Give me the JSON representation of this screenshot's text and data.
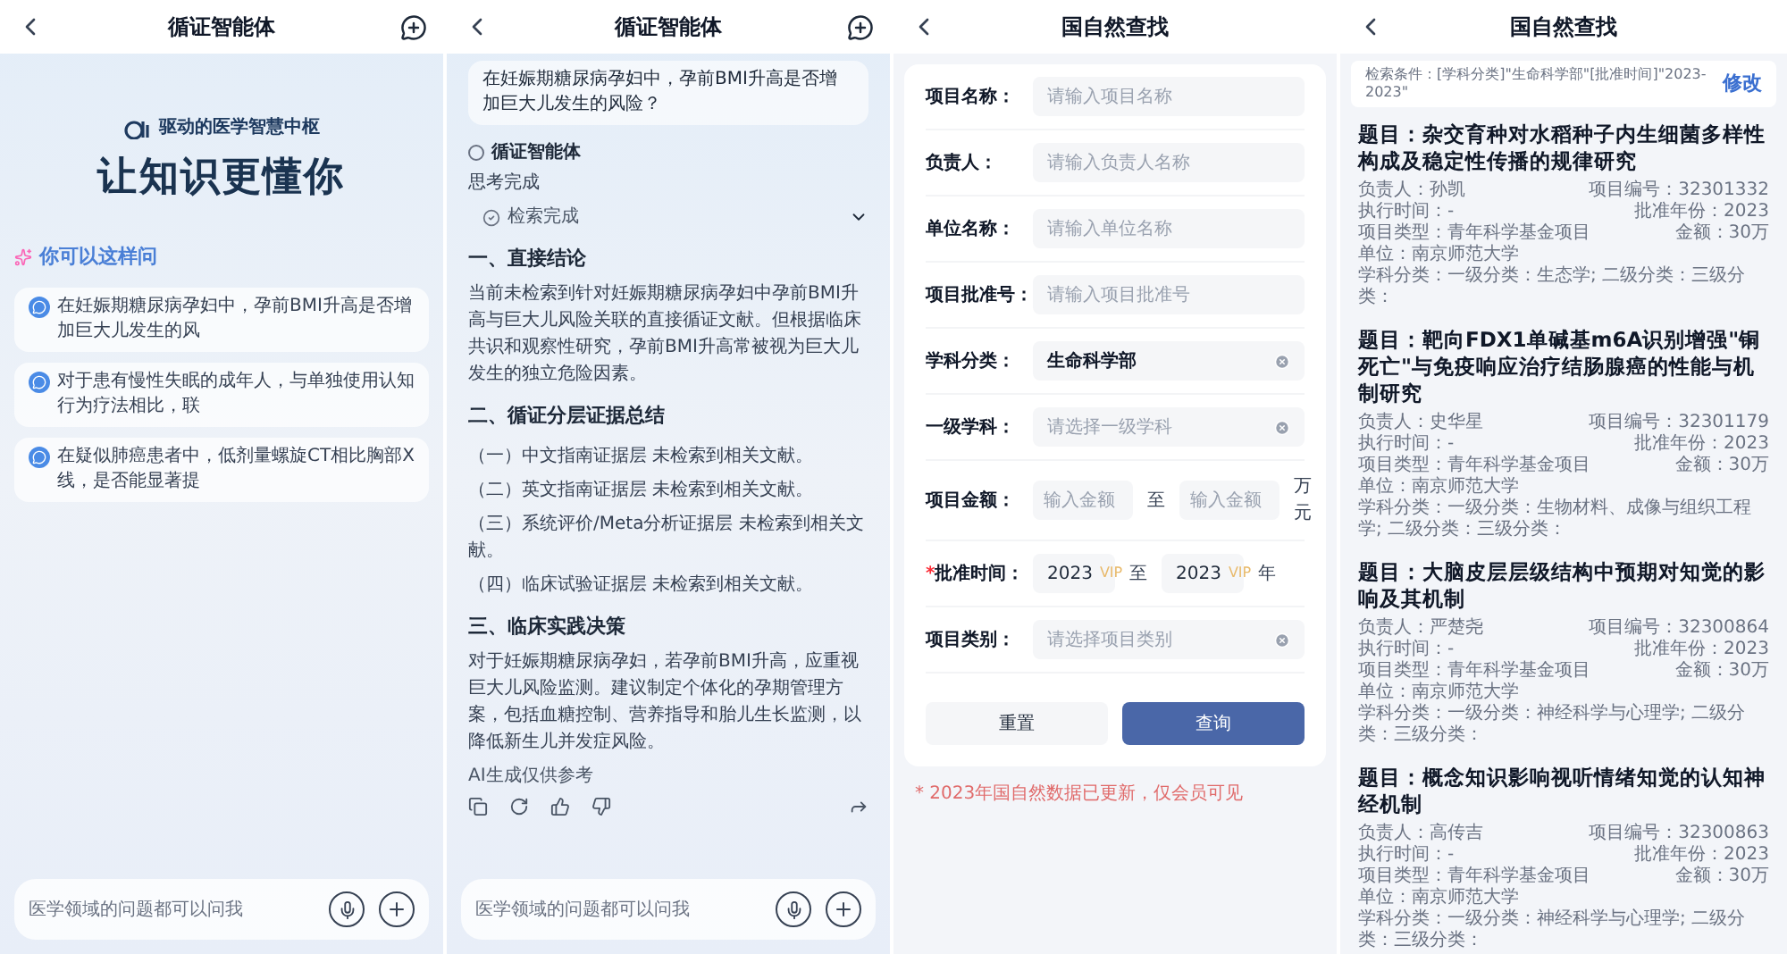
{
  "chat_home": {
    "title": "循证智能体",
    "tagline": "驱动的医学智慧中枢",
    "headline": "让知识更懂你",
    "suggestions_title": "你可以这样问",
    "suggestions": [
      "在妊娠期糖尿病孕妇中，孕前BMI升高是否增加巨大儿发生的风",
      "对于患有慢性失眠的成年人，与单独使用认知行为疗法相比，联",
      "在疑似肺癌患者中，低剂量螺旋CT相比胸部X线，是否能显著提"
    ],
    "input": {
      "placeholder": "医学领域的问题都可以问我"
    }
  },
  "chat_answer": {
    "title": "循证智能体",
    "question": "在妊娠期糖尿病孕妇中，孕前BMI升高是否增加巨大儿发生的风险？",
    "agent": "循证智能体",
    "status": "思考完成",
    "step": "检索完成",
    "sections": [
      {
        "heading": "一、直接结论",
        "items": [
          "当前未检索到针对妊娠期糖尿病孕妇中孕前BMI升高与巨大儿风险关联的直接循证文献。但根据临床共识和观察性研究，孕前BMI升高常被视为巨大儿发生的独立危险因素。"
        ]
      },
      {
        "heading": "二、循证分层证据总结",
        "items": [
          "（一）中文指南证据层 未检索到相关文献。",
          "（二）英文指南证据层 未检索到相关文献。",
          "（三）系统评价/Meta分析证据层 未检索到相关文献。",
          "（四）临床试验证据层 未检索到相关文献。"
        ]
      },
      {
        "heading": "三、临床实践决策",
        "items": [
          "对于妊娠期糖尿病孕妇，若孕前BMI升高，应重视巨大儿风险监测。建议制定个体化的孕期管理方案，包括血糖控制、营养指导和胎儿生长监测，以降低新生儿并发症风险。"
        ]
      }
    ],
    "disclaimer": "AI生成仅供参考",
    "input": {
      "placeholder": "医学领域的问题都可以问我"
    }
  },
  "search_form": {
    "title": "国自然查找",
    "fields": [
      {
        "kind": "text",
        "label": "项目名称：",
        "placeholder": "请输入项目名称"
      },
      {
        "kind": "text",
        "label": "负责人：",
        "placeholder": "请输入负责人名称"
      },
      {
        "kind": "text",
        "label": "单位名称：",
        "placeholder": "请输入单位名称"
      },
      {
        "kind": "text",
        "label": "项目批准号：",
        "placeholder": "请输入项目批准号"
      },
      {
        "kind": "select",
        "label": "学科分类：",
        "value": "生命科学部"
      },
      {
        "kind": "select",
        "label": "一级学科：",
        "placeholder": "请选择一级学科"
      },
      {
        "kind": "range",
        "label": "项目金额：",
        "from_placeholder": "输入金额",
        "separator": "至",
        "to_placeholder": "输入金额",
        "unit": "万元"
      },
      {
        "kind": "year_range",
        "required_mark": "*",
        "label": "批准时间：",
        "from_value": "2023",
        "from_badge": "VIP",
        "separator": "至",
        "to_value": "2023",
        "to_badge": "VIP",
        "unit": "年"
      },
      {
        "kind": "select",
        "label": "项目类别：",
        "placeholder": "请选择项目类别"
      }
    ],
    "buttons": {
      "reset": "重置",
      "query": "查询"
    },
    "notice": "* 2023年国自然数据已更新，仅会员可见"
  },
  "search_results": {
    "title": "国自然查找",
    "condition": "检索条件：[学科分类]\"生命科学部\"[批准时间]\"2023-2023\"",
    "edit": "修改",
    "projects": [
      {
        "title": "题目：杂交育种对水稻种子内生细菌多样性构成及稳定性传播的规律研究",
        "pi": "负责人：孙凯",
        "number": "项目编号：32301332",
        "time": "执行时间：-",
        "year": "批准年份：2023",
        "type": "项目类型：青年科学基金项目",
        "amount": "金额：30万",
        "unit": "单位：南京师范大学",
        "subject": "学科分类：一级分类：生态学; 二级分类：三级分类："
      },
      {
        "title": "题目：靶向FDX1单碱基m6A识别增强\"铜死亡\"与免疫响应治疗结肠腺癌的性能与机制研究",
        "pi": "负责人：史华星",
        "number": "项目编号：32301179",
        "time": "执行时间：-",
        "year": "批准年份：2023",
        "type": "项目类型：青年科学基金项目",
        "amount": "金额：30万",
        "unit": "单位：南京师范大学",
        "subject": "学科分类：一级分类：生物材料、成像与组织工程学; 二级分类：三级分类："
      },
      {
        "title": "题目：大脑皮层层级结构中预期对知觉的影响及其机制",
        "pi": "负责人：严楚尧",
        "number": "项目编号：32300864",
        "time": "执行时间：-",
        "year": "批准年份：2023",
        "type": "项目类型：青年科学基金项目",
        "amount": "金额：30万",
        "unit": "单位：南京师范大学",
        "subject": "学科分类：一级分类：神经科学与心理学; 二级分类：三级分类："
      },
      {
        "title": "题目：概念知识影响视听情绪知觉的认知神经机制",
        "pi": "负责人：高传吉",
        "number": "项目编号：32300863",
        "time": "执行时间：-",
        "year": "批准年份：2023",
        "type": "项目类型：青年科学基金项目",
        "amount": "金额：30万",
        "unit": "单位：南京师范大学",
        "subject": "学科分类：一级分类：神经科学与心理学; 二级分类：三级分类："
      }
    ]
  }
}
